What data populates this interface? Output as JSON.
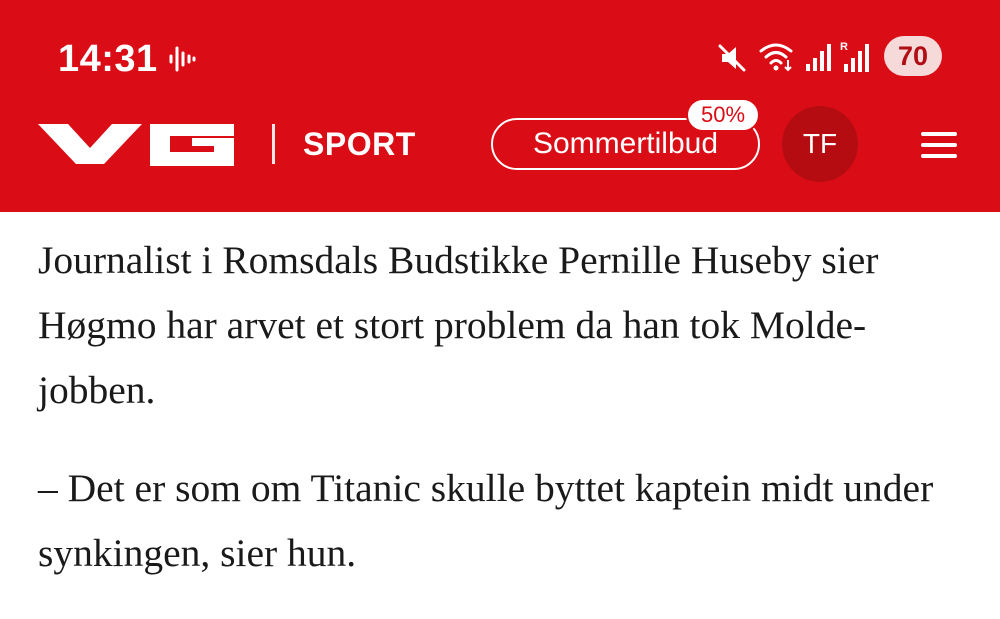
{
  "status_bar": {
    "time": "14:31",
    "battery": "70",
    "icons": [
      "voice-activity-icon",
      "mute-icon",
      "wifi-icon",
      "signal-icon",
      "signal-roaming-icon"
    ]
  },
  "nav": {
    "logo": "VG",
    "section": "SPORT",
    "offer_label": "Sommertilbud",
    "offer_badge": "50%",
    "avatar_initials": "TF",
    "menu_icon": "hamburger-menu-icon",
    "brand_color": "#da0c15"
  },
  "article": {
    "paragraphs": [
      "Journalist i Romsdals Budstikke Pernille Huseby sier Høgmo har arvet et stort problem da han tok Molde-jobben.",
      "– Det er som om Titanic skulle byttet kaptein midt under synkingen, sier hun."
    ]
  }
}
